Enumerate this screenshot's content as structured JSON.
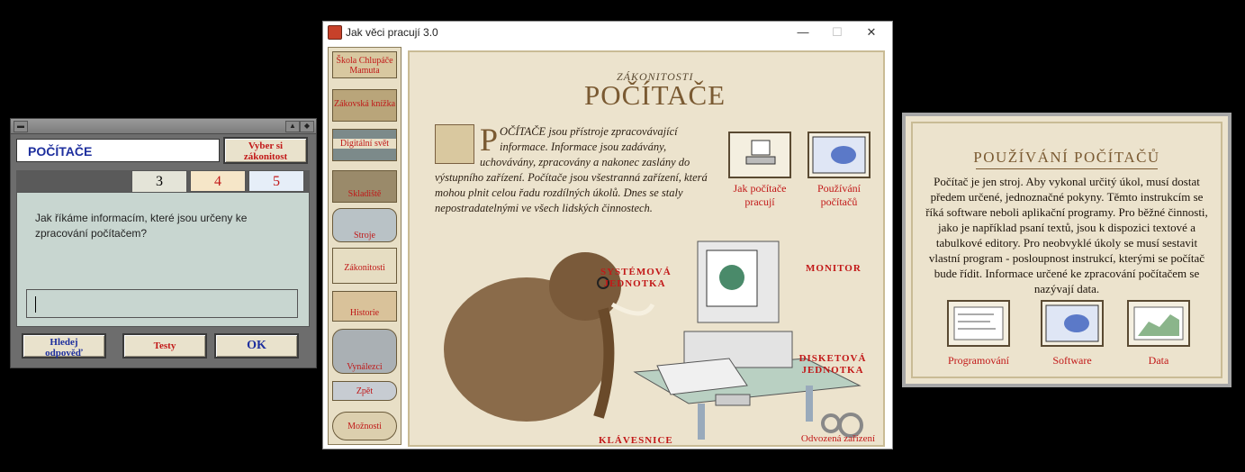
{
  "quiz": {
    "topic": "POČÍTAČE",
    "choose_label_1": "Vyber si",
    "choose_label_2": "zákonitost",
    "tabs": [
      "3",
      "4",
      "5"
    ],
    "question": "Jak říkáme informacím, které jsou určeny ke zpracování počítačem?",
    "answer_value": "",
    "buttons": {
      "search_1": "Hledej",
      "search_2": "odpověď",
      "tests": "Testy",
      "ok": "OK"
    },
    "colors": {
      "tab_active": "#e4e4d8",
      "tab_4": "#f6e6c8",
      "tab_5": "#e6eef8"
    }
  },
  "main": {
    "window_title": "Jak věci pracují 3.0",
    "sidebar": [
      {
        "label": "Škola Chlupáče Mamuta"
      },
      {
        "label": "Zákovská knížka"
      },
      {
        "label": "Digitální svět"
      },
      {
        "label": "Skladiště"
      },
      {
        "label": "Stroje"
      },
      {
        "label": "Zákonitosti"
      },
      {
        "label": "Historie"
      },
      {
        "label": "Vynálezci"
      },
      {
        "label": "Zpět"
      },
      {
        "label": "Možnosti"
      }
    ],
    "section": "ZÁKONITOSTI",
    "title": "POČÍTAČE",
    "dropcap": "P",
    "intro_rest": "OČÍTAČE jsou přístroje zpracovávající informace. Informace jsou zadávány, uchovávány, zpracovány a nakonec zaslány do výstupního zařízení. Počítače jsou všestranná zařízení, která mohou plnit celou řadu rozdílných úkolů. Dnes se staly nepostradatelnými ve všech lidských činnostech.",
    "links": {
      "how_1": "Jak počítače",
      "how_2": "pracují",
      "use_1": "Používání",
      "use_2": "počítačů"
    },
    "callouts": {
      "system_1": "SYSTÉMOVÁ",
      "system_2": "JEDNOTKA",
      "monitor": "MONITOR",
      "disk_1": "DISKETOVÁ",
      "disk_2": "JEDNOTKA",
      "keyboard": "KLÁVESNICE",
      "derived": "Odvozená zařízení"
    }
  },
  "right": {
    "title": "POUŽÍVÁNÍ POČÍTAČŮ",
    "text": "Počítač je jen stroj. Aby vykonal určitý úkol, musí dostat předem určené, jednoznačné pokyny. Těmto instrukcím se říká software neboli aplikační programy. Pro běžné činnosti, jako je například psaní textů, jsou k dispozici textové a tabulkové editory. Pro neobvyklé úkoly se musí sestavit vlastní program - posloupnost instrukcí, kterými se počítač bude řídit. Informace určené ke zpracování počítačem se nazývají data.",
    "items": [
      "Programování",
      "Software",
      "Data"
    ]
  }
}
